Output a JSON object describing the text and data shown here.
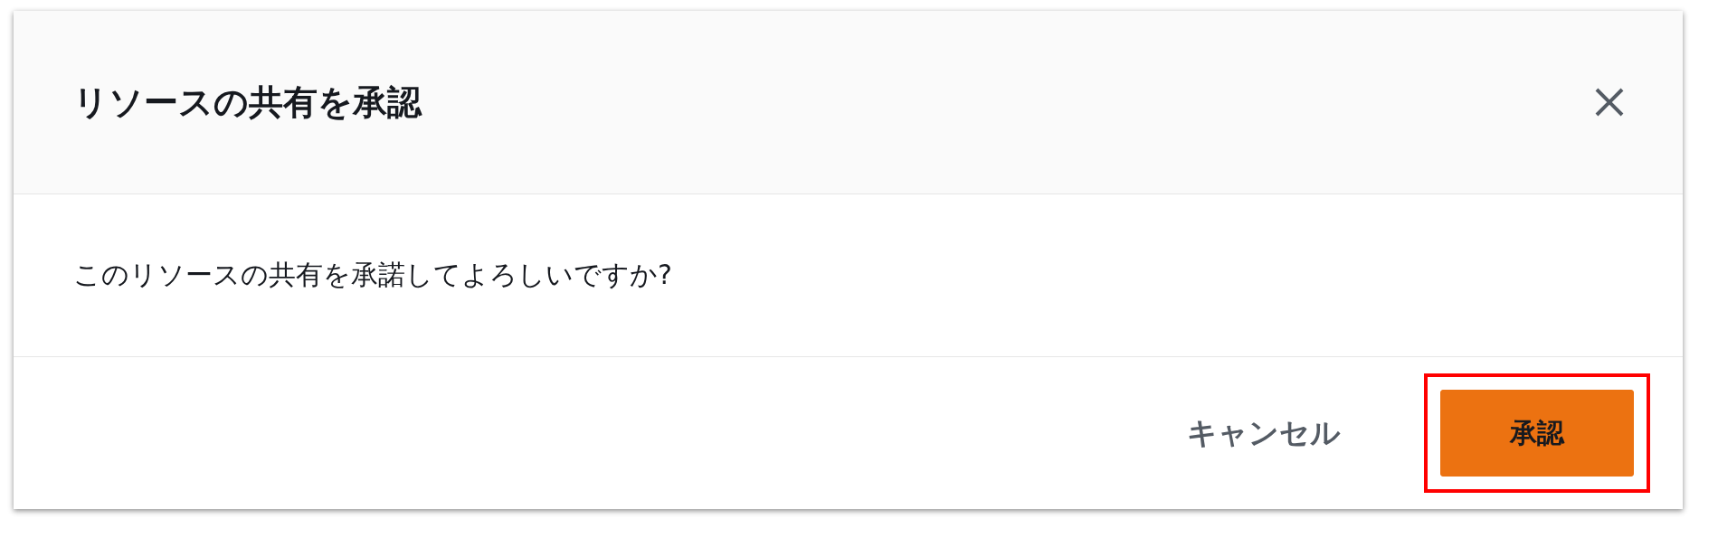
{
  "dialog": {
    "title": "リソースの共有を承認",
    "message": "このリソースの共有を承諾してよろしいですか?",
    "buttons": [
      {
        "label": "キャンセル",
        "kind": "link",
        "highlighted": false
      },
      {
        "label": "承認",
        "kind": "primary",
        "highlighted": true
      }
    ]
  }
}
